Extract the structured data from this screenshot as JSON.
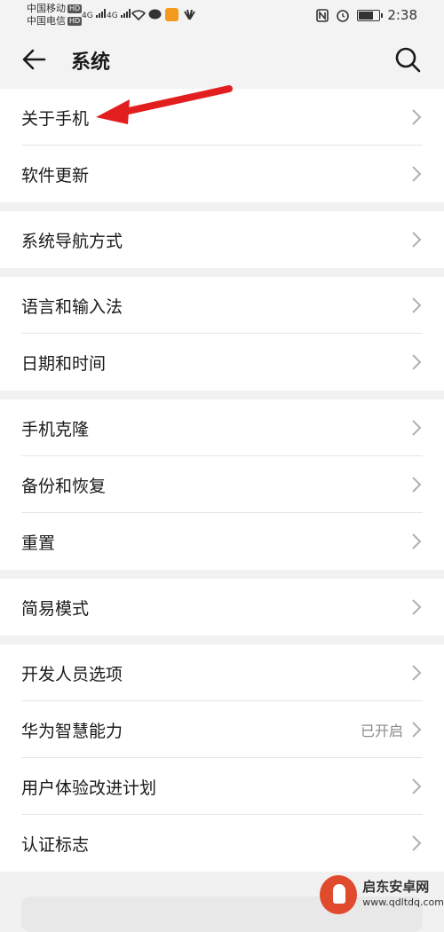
{
  "status_bar": {
    "carrier1": "中国移动",
    "carrier2": "中国电信",
    "hd": "HD",
    "net": "4G",
    "time": "2:38",
    "battery_level": 0.8
  },
  "header": {
    "title": "系统"
  },
  "sections": [
    {
      "items": [
        {
          "label": "关于手机"
        },
        {
          "label": "软件更新"
        }
      ]
    },
    {
      "items": [
        {
          "label": "系统导航方式"
        }
      ]
    },
    {
      "items": [
        {
          "label": "语言和输入法"
        },
        {
          "label": "日期和时间"
        }
      ]
    },
    {
      "items": [
        {
          "label": "手机克隆"
        },
        {
          "label": "备份和恢复"
        },
        {
          "label": "重置"
        }
      ]
    },
    {
      "items": [
        {
          "label": "简易模式"
        }
      ]
    },
    {
      "items": [
        {
          "label": "开发人员选项"
        },
        {
          "label": "华为智慧能力",
          "value": "已开启"
        },
        {
          "label": "用户体验改进计划"
        },
        {
          "label": "认证标志"
        }
      ]
    }
  ],
  "watermark": {
    "name": "启东安卓网",
    "url": "www.qdltdq.com"
  },
  "colors": {
    "annotation_arrow": "#e31e1e"
  }
}
